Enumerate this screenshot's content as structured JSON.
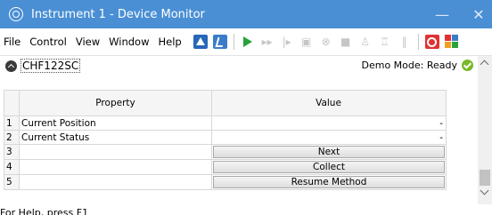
{
  "window": {
    "title": "Instrument 1 - Device Monitor",
    "minimize_glyph": "—",
    "close_glyph": "✕"
  },
  "menu": [
    "File",
    "Control",
    "View",
    "Window",
    "Help"
  ],
  "toolbar_icons": [
    "method-icon",
    "calibrate-icon",
    "run-icon",
    "fast-forward-icon",
    "step-icon",
    "snapshot-icon",
    "abort-icon",
    "stop-icon",
    "bottle-icon",
    "sampler-icon",
    "pause-icon",
    "shutdown-icon",
    "module-icon"
  ],
  "device": {
    "name": "CHF122SC",
    "demo_mode": "Demo Mode: Ready"
  },
  "table": {
    "headers": [
      "Property",
      "Value"
    ],
    "rows": [
      {
        "num": "1",
        "property": "Current Position",
        "value": "-",
        "button": ""
      },
      {
        "num": "2",
        "property": "Current Status",
        "value": "-",
        "button": ""
      },
      {
        "num": "3",
        "property": "",
        "value": "",
        "button": "Next"
      },
      {
        "num": "4",
        "property": "",
        "value": "",
        "button": "Collect"
      },
      {
        "num": "5",
        "property": "",
        "value": "",
        "button": "Resume Method"
      }
    ]
  },
  "statusbar": {
    "text": "For Help, press F1"
  },
  "colors": {
    "titlebar": "#4a8fd4",
    "run_green": "#27a33a",
    "ready_green": "#7ab829",
    "stop_red": "#e03232"
  }
}
